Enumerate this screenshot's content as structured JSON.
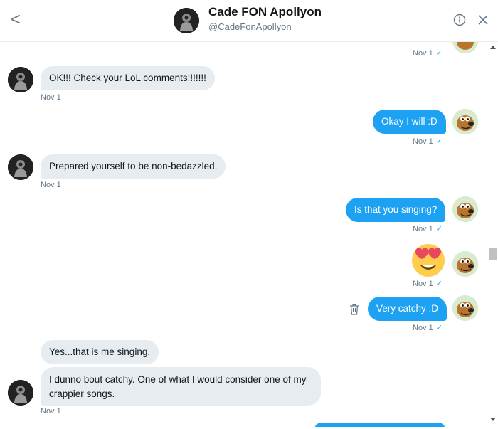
{
  "header": {
    "back_glyph": "<",
    "name": "Cade FON Apollyon",
    "handle": "@CadeFonApollyon"
  },
  "messages": [
    {
      "side": "out",
      "ts": "Nov 1",
      "check": "✓"
    },
    {
      "side": "in",
      "text": "OK!!! Check your LoL comments!!!!!!!",
      "ts": "Nov 1"
    },
    {
      "side": "out",
      "text": "Okay I will :D",
      "ts": "Nov 1",
      "check": "✓"
    },
    {
      "side": "in",
      "text": "Prepared yourself to be non-bedazzled.",
      "ts": "Nov 1"
    },
    {
      "side": "out",
      "text": "Is that you singing?",
      "ts": "Nov 1",
      "check": "✓"
    },
    {
      "side": "out",
      "emoji": "heart-eyes",
      "ts": "Nov 1",
      "check": "✓"
    },
    {
      "side": "out",
      "text": "Very catchy :D",
      "ts": "Nov 1",
      "check": "✓"
    },
    {
      "side": "in",
      "text": "Yes...that is me singing."
    },
    {
      "side": "in",
      "text": "I dunno bout catchy. One of what I would consider one of my crappier songs.",
      "ts": "Nov 1"
    }
  ],
  "colors": {
    "accent": "#1da1f2",
    "incoming_bubble": "#e6ecf0",
    "muted_text": "#657786"
  }
}
